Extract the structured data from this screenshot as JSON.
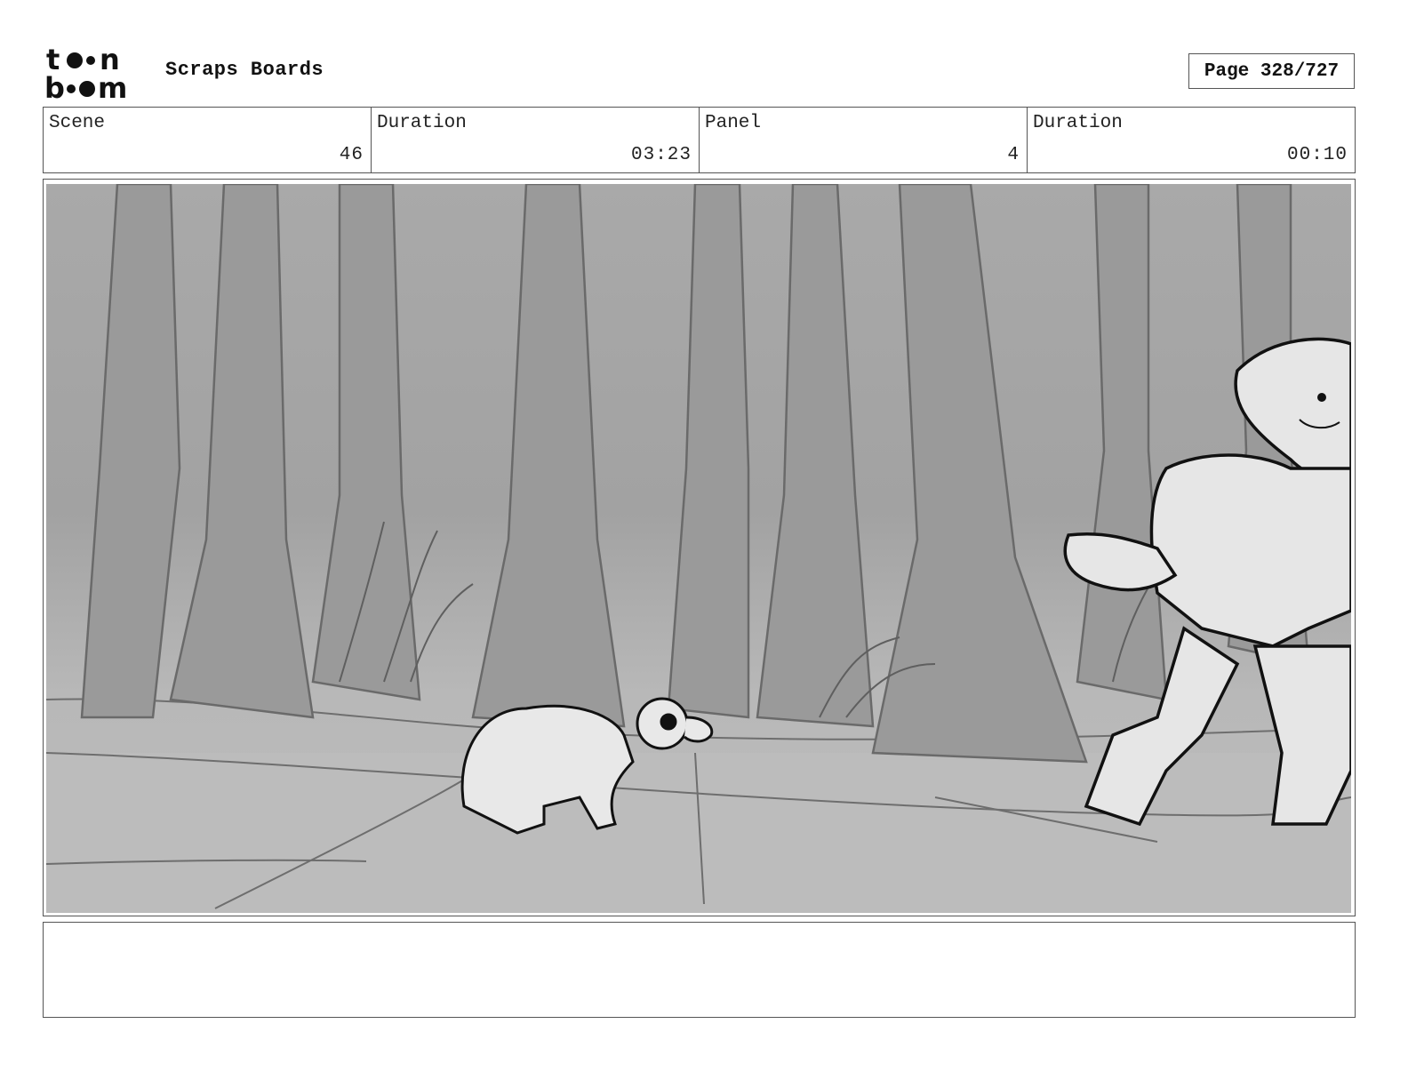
{
  "header": {
    "logo_text_top": "toon",
    "logo_text_bottom": "boom",
    "title": "Scraps Boards",
    "page_label": "Page 328/727"
  },
  "info": {
    "scene_label": "Scene",
    "scene_value": "46",
    "scene_duration_label": "Duration",
    "scene_duration_value": "03:23",
    "panel_label": "Panel",
    "panel_value": "4",
    "panel_duration_label": "Duration",
    "panel_duration_value": "00:10"
  },
  "panel": {
    "image_name": "forest-scene-storyboard-sketch"
  },
  "notes": {
    "text": ""
  }
}
